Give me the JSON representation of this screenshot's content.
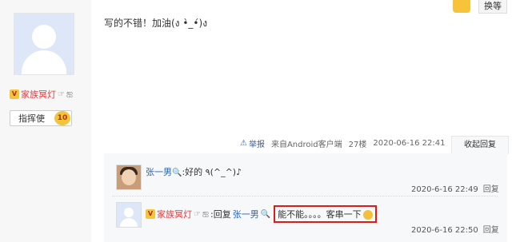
{
  "post": {
    "text": "写的不错！加油(ง •̀_•́)ง",
    "meta": {
      "report": "举报",
      "source": "来自Android客户端",
      "floor": "27楼",
      "timestamp": "2020-06-16 22:41"
    },
    "fold_label": "收起回复"
  },
  "author": {
    "name": "家族冥灯",
    "title": "指挥使",
    "level": "10"
  },
  "top_right": {
    "button_label": "换等"
  },
  "replies": [
    {
      "user": "张一男",
      "text": ":好的 ٩(^_^)♪",
      "time": "2020-6-16 22:49",
      "reply_label": "回复"
    },
    {
      "user": "家族冥灯",
      "prefix": ":回复",
      "target": "张一男",
      "text": "能不能。。。。客串一下",
      "time": "2020-6-16 22:50",
      "reply_label": "回复"
    }
  ]
}
